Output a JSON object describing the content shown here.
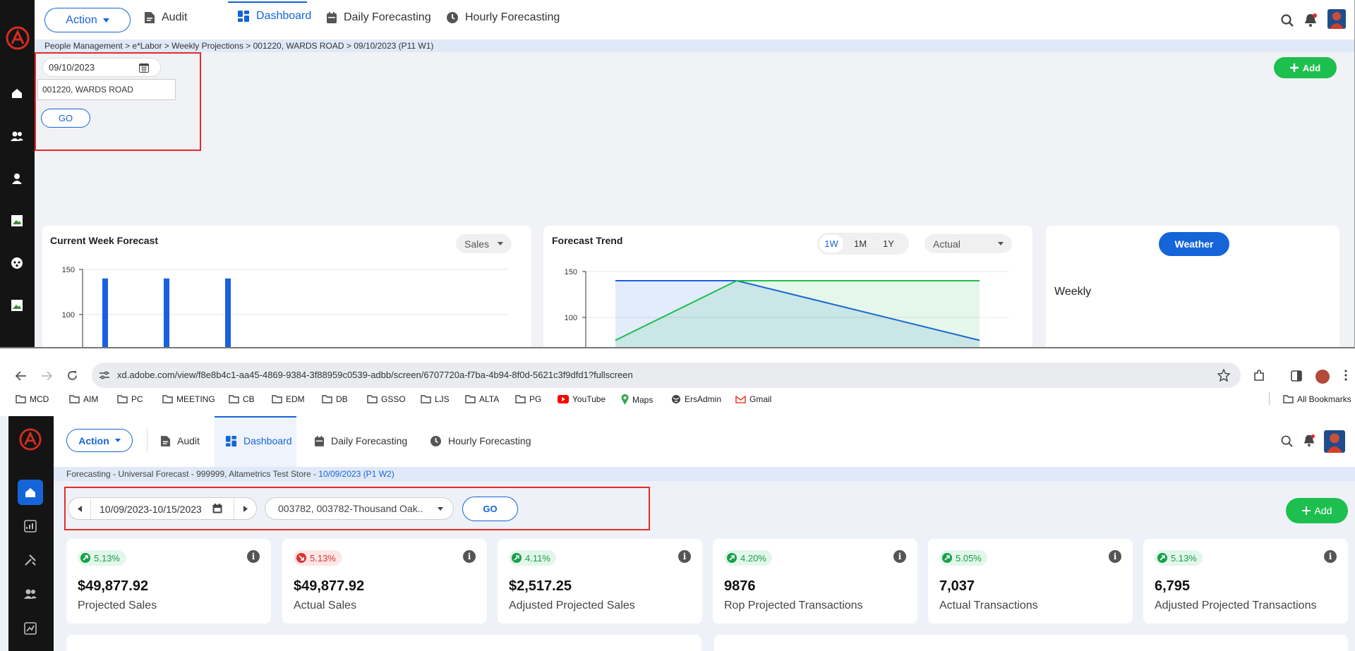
{
  "top": {
    "action_label": "Action",
    "nav": [
      {
        "label": "Audit"
      },
      {
        "label": "Dashboard"
      },
      {
        "label": "Daily Forecasting"
      },
      {
        "label": "Hourly Forecasting"
      }
    ],
    "breadcrumb": "People Management > e*Labor > Weekly Projections  > 001220, WARDS ROAD > 09/10/2023 (P11 W1)",
    "date_value": "09/10/2023",
    "store_value": "001220, WARDS ROAD",
    "go_label": "GO",
    "add_label": "Add",
    "current_week": {
      "title": "Current Week Forecast",
      "select_value": "Sales",
      "y_ticks": [
        "150",
        "100"
      ]
    },
    "trend": {
      "title": "Forecast Trend",
      "ranges": [
        "1W",
        "1M",
        "1Y"
      ],
      "active_range": "1W",
      "select_value": "Actual",
      "y_ticks": [
        "150",
        "100"
      ]
    },
    "weather": {
      "button_label": "Weather",
      "period_label": "Weekly"
    }
  },
  "chrome": {
    "url": "xd.adobe.com/view/f8e8b4c1-aa45-4869-9384-3f88959c0539-adbb/screen/6707720a-f7ba-4b94-8f0d-5621c3f9dfd1?fullscreen",
    "bookmarks": [
      "MCD",
      "AIM",
      "PC",
      "MEETING",
      "CB",
      "EDM",
      "DB",
      "GSSO",
      "LJS",
      "ALTA",
      "PG",
      "YouTube",
      "Maps",
      "ErsAdmin",
      "Gmail"
    ],
    "all_bookmarks_label": "All Bookmarks"
  },
  "bottom": {
    "action_label": "Action",
    "nav": [
      {
        "label": "Audit"
      },
      {
        "label": "Dashboard"
      },
      {
        "label": "Daily Forecasting"
      },
      {
        "label": "Hourly Forecasting"
      }
    ],
    "breadcrumb": {
      "parts": [
        "Forecasting",
        "Universal Forecast",
        "999999, Altametrics Test Store"
      ],
      "current": "10/09/2023 (P1 W2)",
      "separator": " - "
    },
    "date_range": "10/09/2023-10/15/2023",
    "store_select": "003782, 003782-Thousand Oak..",
    "go_label": "GO",
    "add_label": "Add",
    "kpis": [
      {
        "pct": "5.13%",
        "trend": "up",
        "value": "$49,877.92",
        "label": "Projected Sales"
      },
      {
        "pct": "5.13%",
        "trend": "down",
        "value": "$49,877.92",
        "label": "Actual Sales"
      },
      {
        "pct": "4.11%",
        "trend": "up",
        "value": "$2,517.25",
        "label": "Adjusted Projected Sales"
      },
      {
        "pct": "4.20%",
        "trend": "up",
        "value": "9876",
        "label": "Rop Projected Transactions"
      },
      {
        "pct": "5.05%",
        "trend": "up",
        "value": "7,037",
        "label": "Actual Transactions"
      },
      {
        "pct": "5.13%",
        "trend": "up",
        "value": "6,795",
        "label": "Adjusted Projected Transactions"
      }
    ]
  },
  "colors": {
    "accent": "#1565d8",
    "success": "#1dbf4f",
    "danger": "#d93434",
    "highlight_box": "#e52b2b"
  },
  "chart_data": [
    {
      "type": "bar",
      "title": "Current Week Forecast",
      "categories": [
        "",
        "",
        ""
      ],
      "values": [
        140,
        140,
        140
      ],
      "ylim": [
        0,
        150
      ]
    },
    {
      "type": "area",
      "title": "Forecast Trend",
      "x": [
        0,
        1,
        2
      ],
      "series": [
        {
          "values": [
            140,
            140,
            75
          ]
        },
        {
          "values": [
            75,
            140,
            140
          ]
        }
      ],
      "ylim": [
        0,
        150
      ]
    }
  ]
}
